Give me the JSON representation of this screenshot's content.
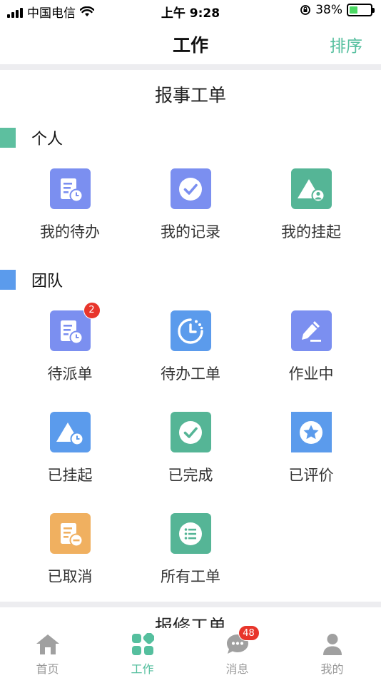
{
  "status": {
    "carrier": "中国电信",
    "time": "上午 9:28",
    "battery": "38%"
  },
  "nav": {
    "title": "工作",
    "action": "排序"
  },
  "section": {
    "title": "报事工单",
    "next_title": "报修工单"
  },
  "groups": [
    {
      "label": "个人",
      "color": "#5dbf9f",
      "items": [
        {
          "label": "我的待办",
          "icon": "clipboard-clock-icon",
          "color": "#7b8ff0"
        },
        {
          "label": "我的记录",
          "icon": "check-circle-icon",
          "color": "#7b8ff0"
        },
        {
          "label": "我的挂起",
          "icon": "triangle-user-icon",
          "color": "#55b596"
        }
      ]
    },
    {
      "label": "团队",
      "color": "#5b9bec",
      "items": [
        {
          "label": "待派单",
          "icon": "clipboard-clock-icon",
          "color": "#7b8ff0",
          "badge": "2"
        },
        {
          "label": "待办工单",
          "icon": "clock-ring-icon",
          "color": "#5b9bec"
        },
        {
          "label": "作业中",
          "icon": "pencil-edit-icon",
          "color": "#7b8ff0"
        },
        {
          "label": "已挂起",
          "icon": "triangle-clock-icon",
          "color": "#5b9bec"
        },
        {
          "label": "已完成",
          "icon": "check-circle-icon",
          "color": "#55b596"
        },
        {
          "label": "已评价",
          "icon": "star-badge-icon",
          "color": "#5b9bec"
        },
        {
          "label": "已取消",
          "icon": "clipboard-minus-icon",
          "color": "#f0b060"
        },
        {
          "label": "所有工单",
          "icon": "list-circle-icon",
          "color": "#55b596"
        }
      ]
    }
  ],
  "tabs": [
    {
      "label": "首页",
      "icon": "home-icon"
    },
    {
      "label": "工作",
      "icon": "grid-icon",
      "active": true
    },
    {
      "label": "消息",
      "icon": "chat-bubble-icon",
      "badge": "48"
    },
    {
      "label": "我的",
      "icon": "user-icon"
    }
  ],
  "colors": {
    "accent": "#55bf9e",
    "badge": "#e8352b",
    "inactive": "#999999"
  }
}
